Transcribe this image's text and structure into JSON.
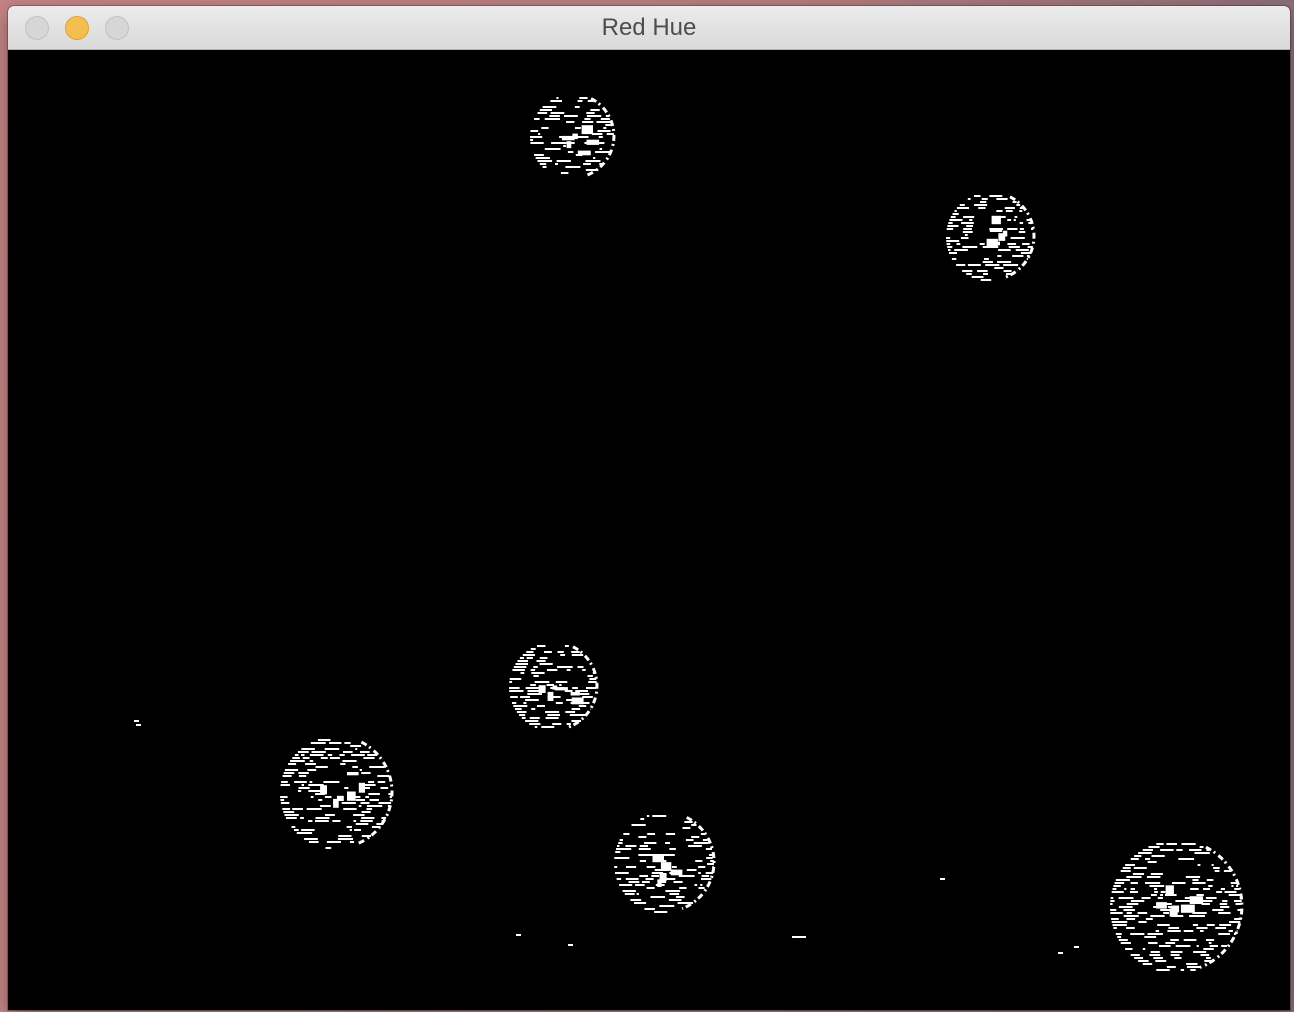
{
  "window": {
    "title": "Red Hue",
    "traffic_lights": {
      "close_color": "#d6d6d6",
      "minimize_color": "#f5bf4f",
      "zoom_color": "#d6d6d6"
    }
  },
  "image_view": {
    "background_color": "#000000",
    "foreground_color": "#ffffff",
    "content": "binary-mask"
  }
}
